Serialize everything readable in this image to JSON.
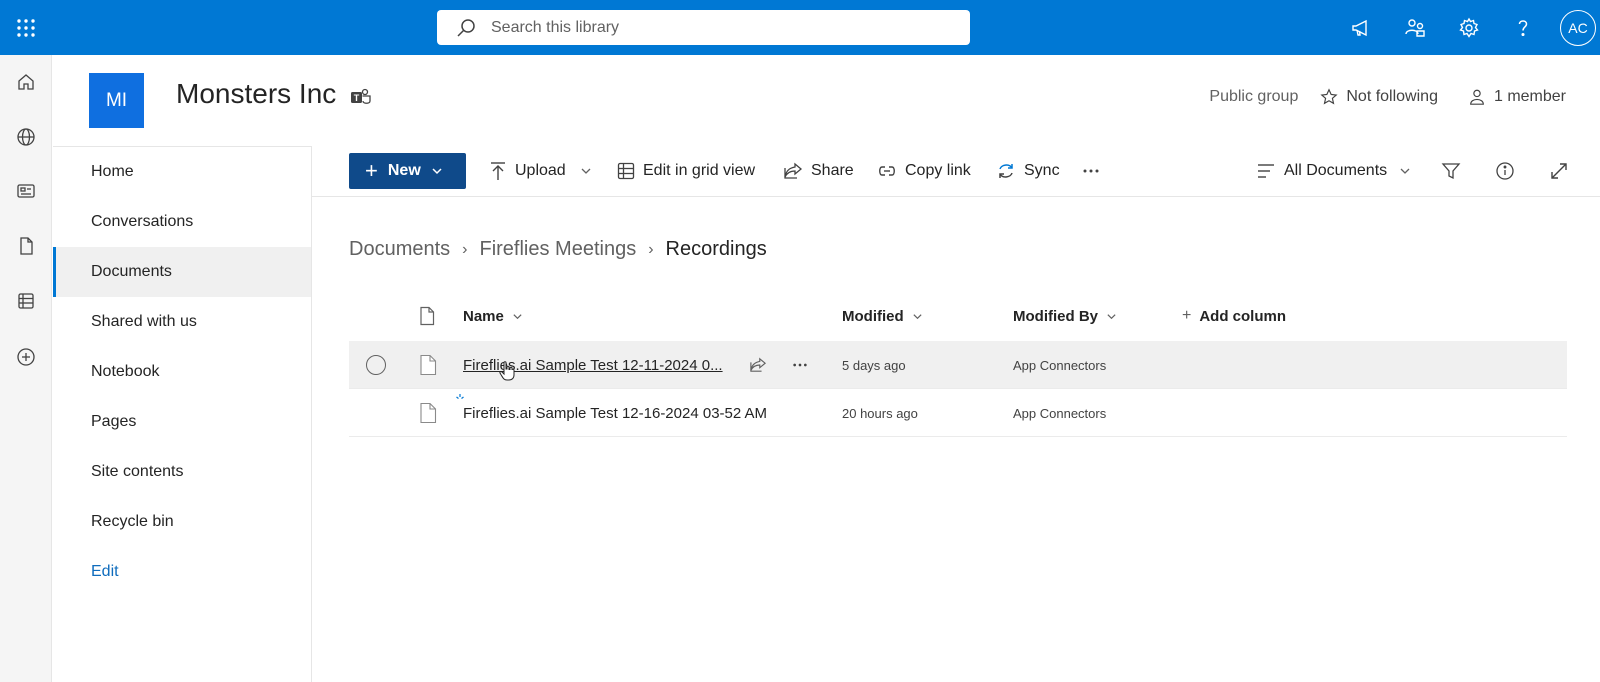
{
  "search": {
    "placeholder": "Search this library"
  },
  "user": {
    "initials": "AC"
  },
  "site": {
    "logo": "MI",
    "title": "Monsters Inc",
    "privacy": "Public group",
    "follow": "Not following",
    "members": "1 member"
  },
  "nav": {
    "items": [
      {
        "label": "Home"
      },
      {
        "label": "Conversations"
      },
      {
        "label": "Documents"
      },
      {
        "label": "Shared with us"
      },
      {
        "label": "Notebook"
      },
      {
        "label": "Pages"
      },
      {
        "label": "Site contents"
      },
      {
        "label": "Recycle bin"
      }
    ],
    "edit": "Edit"
  },
  "commands": {
    "new": "New",
    "upload": "Upload",
    "grid": "Edit in grid view",
    "share": "Share",
    "copylink": "Copy link",
    "sync": "Sync",
    "view": "All Documents"
  },
  "breadcrumb": [
    "Documents",
    "Fireflies Meetings",
    "Recordings"
  ],
  "columns": {
    "name": "Name",
    "modified": "Modified",
    "modified_by": "Modified By",
    "add": "Add column"
  },
  "files": [
    {
      "name": "Fireflies.ai Sample Test 12-11-2024 0...",
      "modified": "5 days ago",
      "modified_by": "App Connectors"
    },
    {
      "name": "Fireflies.ai Sample Test 12-16-2024 03-52 AM",
      "modified": "20 hours ago",
      "modified_by": "App Connectors"
    }
  ],
  "icons": {
    "topbar": [
      "waffle-icon",
      "megaphone-icon",
      "people-settings-icon",
      "gear-icon",
      "help-icon"
    ],
    "rail": [
      "home-icon",
      "globe-icon",
      "news-icon",
      "file-icon",
      "list-icon",
      "add-icon"
    ]
  },
  "colors": {
    "suite_bar": "#0078d4",
    "new_button": "#0f4a8a",
    "site_logo": "#0f6fe0"
  }
}
